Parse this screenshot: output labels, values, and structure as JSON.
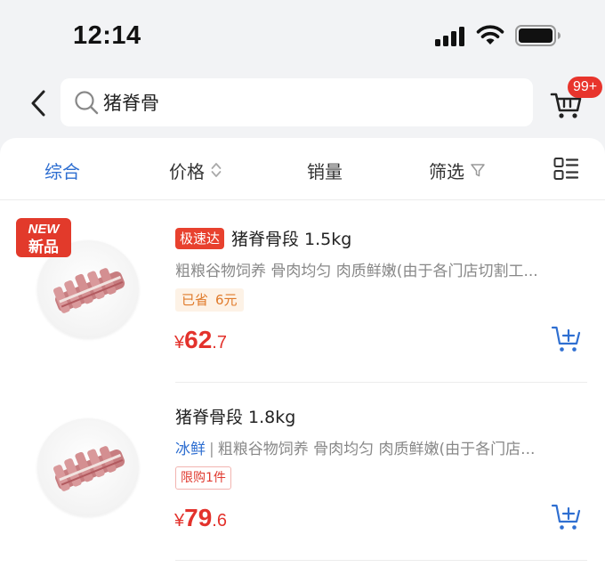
{
  "status_bar": {
    "time": "12:14"
  },
  "search": {
    "query": "猪脊骨"
  },
  "cart": {
    "badge": "99+"
  },
  "sort_tabs": {
    "default": "综合",
    "price": "价格",
    "sales": "销量",
    "filter": "筛选"
  },
  "products": [
    {
      "badge_line1": "NEW",
      "badge_line2": "新品",
      "tag": "极速达",
      "title": "猪脊骨段 1.5kg",
      "description": "粗粮谷物饲养 骨肉均匀 肉质鲜嫩(由于各门店切割工...",
      "saved_label": "已省",
      "saved_amount": "6元",
      "price_currency": "¥",
      "price_int": "62",
      "price_dec": ".7"
    },
    {
      "title": "猪脊骨段 1.8kg",
      "fresh_label": "冰鲜",
      "separator": "|",
      "description": "粗粮谷物饲养 骨肉均匀 肉质鲜嫩(由于各门店...",
      "limit_label": "限购1件",
      "price_currency": "¥",
      "price_int": "79",
      "price_dec": ".6"
    }
  ],
  "colors": {
    "accent": "#2f6fd1",
    "price_red": "#e3322c",
    "badge_red": "#e8342c",
    "saved_orange": "#e07a2a"
  },
  "icons": {
    "back": "chevron-left-icon",
    "search": "search-icon",
    "cart": "cart-icon",
    "price_sort": "sort-arrows-icon",
    "filter": "funnel-icon",
    "layout": "list-layout-icon",
    "add_cart": "add-to-cart-icon"
  }
}
